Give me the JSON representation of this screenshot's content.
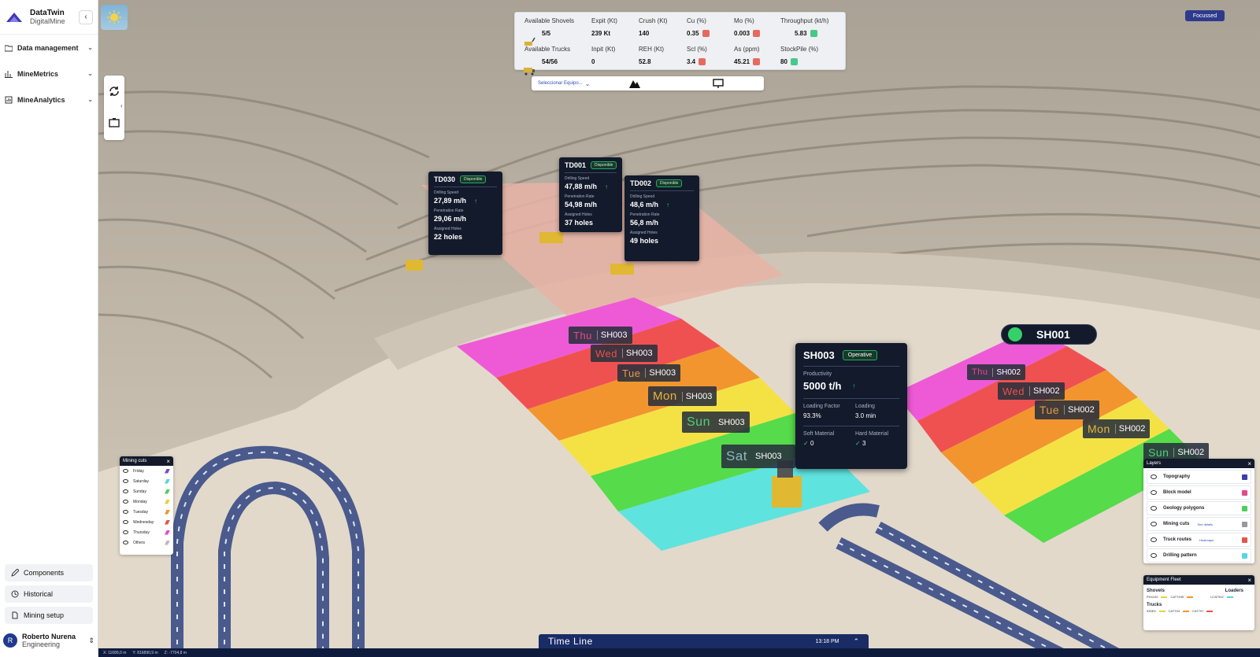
{
  "brand": {
    "title": "DataTwin",
    "subtitle": "DigitalMine"
  },
  "nav": [
    {
      "label": "Data management",
      "icon": "folder-icon"
    },
    {
      "label": "MineMetrics",
      "icon": "bar-chart-icon"
    },
    {
      "label": "MineAnalytics",
      "icon": "analytics-icon"
    }
  ],
  "bottom_nav": [
    {
      "label": "Components",
      "icon": "pencil-icon"
    },
    {
      "label": "Historical",
      "icon": "clock-icon"
    },
    {
      "label": "Mining setup",
      "icon": "file-icon"
    }
  ],
  "user": {
    "name": "Roberto Nurena",
    "role": "Engineering",
    "initial": "R"
  },
  "stats": [
    {
      "label": "Available Shovels",
      "value": "5/5"
    },
    {
      "label": "Expit (Kt)",
      "value": "239 Kt"
    },
    {
      "label": "Crush (Kt)",
      "value": "140"
    },
    {
      "label": "Cu (%)",
      "value": "0.35",
      "trend": "down"
    },
    {
      "label": "Mo (%)",
      "value": "0.003",
      "trend": "down"
    },
    {
      "label": "Throughput (kt/h)",
      "value": "5.83",
      "trend": "up"
    },
    {
      "label": "Available Trucks",
      "value": "54/56"
    },
    {
      "label": "Inpit (Kt)",
      "value": "0"
    },
    {
      "label": "REH (Kt)",
      "value": "52.8"
    },
    {
      "label": "Scl (%)",
      "value": "3.4",
      "trend": "down"
    },
    {
      "label": "As (ppm)",
      "value": "45.21",
      "trend": "down"
    },
    {
      "label": "StockPile (%)",
      "value": "80",
      "trend": "up"
    }
  ],
  "selector": {
    "label": "Seleccionar Equipo..."
  },
  "focus_badge": "Focussed",
  "drills": [
    {
      "id": "TD030",
      "status": "Disponible",
      "l1": "Drilling Speed",
      "v1": "27,89 m/h",
      "l2": "Penetration Rate",
      "v2": "29,06 m/h",
      "l3": "Assigned Holes",
      "v3": "22 holes"
    },
    {
      "id": "TD001",
      "status": "Disponible",
      "l1": "Drilling Speed",
      "v1": "47,88 m/h",
      "l2": "Penetration Rate",
      "v2": "54,98 m/h",
      "l3": "Assigned Holes",
      "v3": "37 holes"
    },
    {
      "id": "TD002",
      "status": "Disponible",
      "l1": "Drilling Speed",
      "v1": "48,6 m/h",
      "l2": "Penetration Rate",
      "v2": "56,8 m/h",
      "l3": "Assigned Holes",
      "v3": "49 holes"
    }
  ],
  "days_left": [
    {
      "day": "Thu",
      "shovel": "SH003",
      "color": "#e14b86"
    },
    {
      "day": "Wed",
      "shovel": "SH003",
      "color": "#e8524b"
    },
    {
      "day": "Tue",
      "shovel": "SH003",
      "color": "#e59a47"
    },
    {
      "day": "Mon",
      "shovel": "SH003",
      "color": "#e5b640"
    },
    {
      "day": "Sun",
      "shovel": "SH003",
      "color": "#4fce7a"
    },
    {
      "day": "Sat",
      "shovel": "SH003",
      "color": "#8fb7c0"
    }
  ],
  "days_right": [
    {
      "day": "Thu",
      "shovel": "SH002",
      "color": "#e14b86"
    },
    {
      "day": "Wed",
      "shovel": "SH002",
      "color": "#e8524b"
    },
    {
      "day": "Tue",
      "shovel": "SH002",
      "color": "#e59a47"
    },
    {
      "day": "Mon",
      "shovel": "SH002",
      "color": "#e5b640"
    },
    {
      "day": "Sun",
      "shovel": "SH002",
      "color": "#4fce7a"
    }
  ],
  "shovel_card": {
    "id": "SH003",
    "status": "Operative",
    "prod_label": "Productivity",
    "prod": "5000 t/h",
    "lf_label": "Loading Factor",
    "lf": "93.3%",
    "ld_label": "Loading",
    "ld": "3.0 min",
    "soft_label": "Soft Material",
    "soft": "0",
    "hard_label": "Hard Material",
    "hard": "3"
  },
  "sh001": "SH001",
  "mining_cuts": {
    "title": "Mining cuts",
    "items": [
      {
        "label": "Friday",
        "color": "#6b4fd8"
      },
      {
        "label": "Saturday",
        "color": "#5ad4e0"
      },
      {
        "label": "Sunday",
        "color": "#4fce5a"
      },
      {
        "label": "Monday",
        "color": "#e8d23c"
      },
      {
        "label": "Tuesday",
        "color": "#f0962e"
      },
      {
        "label": "Wednesday",
        "color": "#e8524b"
      },
      {
        "label": "Thursday",
        "color": "#e14bd0"
      },
      {
        "label": "Others",
        "color": "#bbbbbb"
      }
    ]
  },
  "layers": {
    "title": "Layers",
    "items": [
      {
        "label": "Topography",
        "color": "#3d3fa8",
        "extra": ""
      },
      {
        "label": "Block model",
        "color": "#e14b86",
        "extra": ""
      },
      {
        "label": "Geology polygons",
        "color": "#4fce5a",
        "extra": ""
      },
      {
        "label": "Mining cuts",
        "color": "#999999",
        "extra": "See details"
      },
      {
        "label": "Truck routes",
        "color": "#e8524b",
        "extra": "Heatmaps"
      },
      {
        "label": "Drilling pattern",
        "color": "#5ad4e0",
        "extra": ""
      }
    ]
  },
  "fleet": {
    "title": "Equipment Fleet",
    "shovels_label": "Shovels",
    "loaders_label": "Loaders",
    "trucks_label": "Trucks",
    "shovels": [
      {
        "name": "PH4100",
        "color": "#e8d23c"
      },
      {
        "name": "CAT7495",
        "color": "#f0962e"
      }
    ],
    "loaders": [
      {
        "name": "LCAT992",
        "color": "#5ad4e0"
      }
    ],
    "trucks": [
      {
        "name": "930E5",
        "color": "#e8d23c"
      },
      {
        "name": "CAT793",
        "color": "#f0962e"
      },
      {
        "name": "CAT797",
        "color": "#e8524b"
      }
    ]
  },
  "timeline": {
    "title": "Time Line",
    "time": "13:18 PM"
  },
  "coords": {
    "x": "X: 11689,0 m",
    "y": "Y: 816890,9 m",
    "z": "Z: -7704,8 m"
  }
}
